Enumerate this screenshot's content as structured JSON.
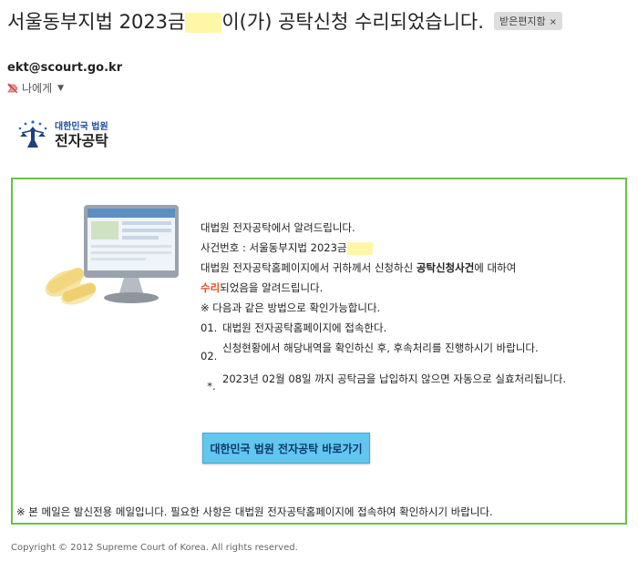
{
  "email": {
    "subject_prefix": "서울동부지법 2023금",
    "subject_suffix": "이(가) 공탁신청 수리되었습니다.",
    "label": "받은편지함",
    "label_close": "×",
    "sender": "ekt@scourt.go.kr",
    "recipient": "나에게",
    "recipient_dropdown": "▼"
  },
  "logo": {
    "top": "대한민국 법원",
    "main": "전자공탁"
  },
  "body": {
    "line1": "대법원 전자공탁에서 알려드립니다.",
    "line2_prefix": "사건번호 : 서울동부지법 2023금",
    "line3_a": "대법원 전자공탁홈페이지에서 귀하께서 신청하신 ",
    "line3_bold": "공탁신청사건",
    "line3_b": "에 대하여",
    "line4_red": "수리",
    "line4_rest": "되었음을 알려드립니다.",
    "note": "※ 다음과 같은 방법으로 확인가능합니다.",
    "steps": [
      {
        "num": "01.",
        "text": "대법원 전자공탁홈페이지에 접속한다."
      },
      {
        "num": "02.",
        "text": "신청현황에서 해당내역을 확인하신 후, 후속처리를 진행하시기 바랍니다."
      },
      {
        "num": "*.",
        "text": "2023년 02월 08일 까지 공탁금을 납입하지 않으면 자동으로 실효처리됩니다."
      }
    ],
    "cta": "대한민국 법원 전자공탁 바로가기",
    "footer_note": "※ 본 메일은 발신전용 메일입니다. 필요한 사항은 대법원 전자공탁홈페이지에 접속하여 확인하시기 바랍니다."
  },
  "copyright": "Copyright © 2012 Supreme Court of Korea. All rights reserved.",
  "colors": {
    "frame_border": "#6abf4b",
    "cta_bg": "#63c6ee",
    "accent_red": "#e0501b",
    "redaction": "#fff7a8"
  }
}
